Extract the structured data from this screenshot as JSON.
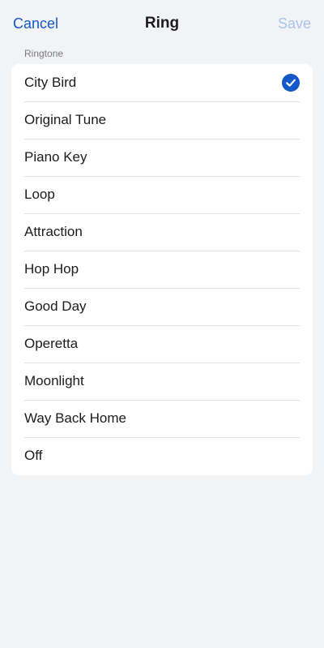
{
  "nav": {
    "cancel_label": "Cancel",
    "title": "Ring",
    "save_label": "Save"
  },
  "section": {
    "label": "Ringtone"
  },
  "ringtones": {
    "selected": "City Bird",
    "items": [
      "City Bird",
      "Original Tune",
      "Piano Key",
      "Loop",
      "Attraction",
      "Hop Hop",
      "Good Day",
      "Operetta",
      "Moonlight",
      "Way Back Home",
      "Off"
    ]
  },
  "colors": {
    "accent": "#1457c8",
    "save_disabled": "#a9c3ec",
    "background": "#f2f3f5"
  },
  "icons": {
    "selected": "checkmark-circle-icon"
  }
}
